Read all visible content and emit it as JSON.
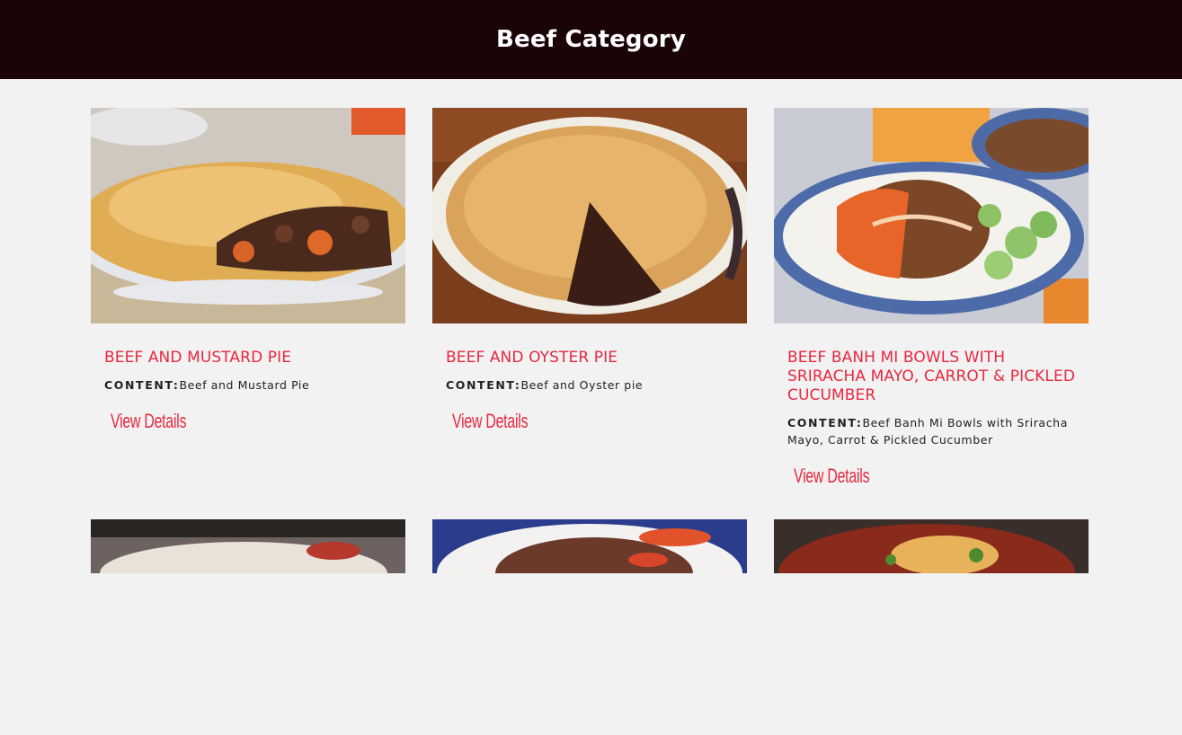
{
  "header": {
    "title": "Beef Category"
  },
  "cards": [
    {
      "title": "Beef and Mustard Pie",
      "content_label": "CONTENT:",
      "content": "Beef and Mustard Pie",
      "link": "View Details"
    },
    {
      "title": "Beef and Oyster pie",
      "content_label": "CONTENT:",
      "content": "Beef and Oyster pie",
      "link": "View Details"
    },
    {
      "title": "Beef Banh Mi Bowls with Sriracha Mayo, Carrot & Pickled Cucumber",
      "content_label": "CONTENT:",
      "content": "Beef Banh Mi Bowls with Sriracha Mayo, Carrot & Pickled Cucumber",
      "link": "View Details"
    }
  ],
  "colors": {
    "header_bg": "#1b0407",
    "accent": "#e8283f",
    "page_bg": "#f2f2f2"
  }
}
